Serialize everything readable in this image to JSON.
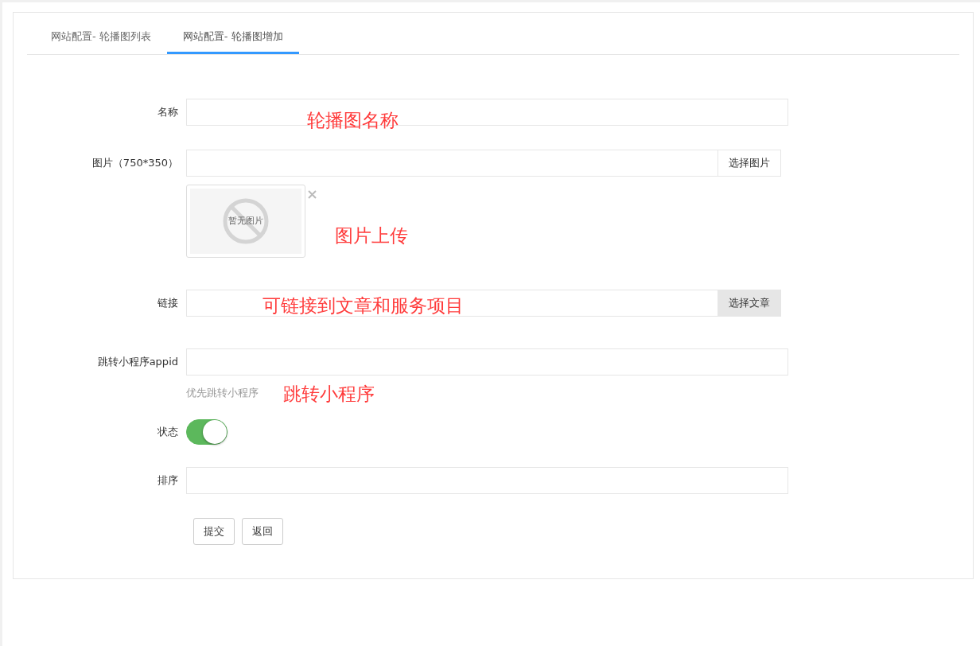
{
  "tabs": [
    {
      "label": "网站配置- 轮播图列表",
      "selected": false
    },
    {
      "label": "网站配置- 轮播图增加",
      "selected": true
    }
  ],
  "form": {
    "fields": [
      {
        "kind": "text",
        "label": "名称",
        "note": "轮播图名称"
      },
      {
        "kind": "image",
        "label": "图片（750*350）",
        "button": "选择图片",
        "preview_text": "暂无图片",
        "note": "图片上传"
      },
      {
        "kind": "picker",
        "label": "链接",
        "button": "选择文章",
        "note": "可链接到文章和服务项目"
      },
      {
        "kind": "text",
        "label": "跳转小程序appid",
        "help": "优先跳转小程序",
        "note": "跳转小程序"
      },
      {
        "kind": "switch",
        "label": "状态",
        "on": true
      },
      {
        "kind": "text",
        "label": "排序"
      }
    ],
    "buttons": [
      "提交",
      "返回"
    ]
  }
}
